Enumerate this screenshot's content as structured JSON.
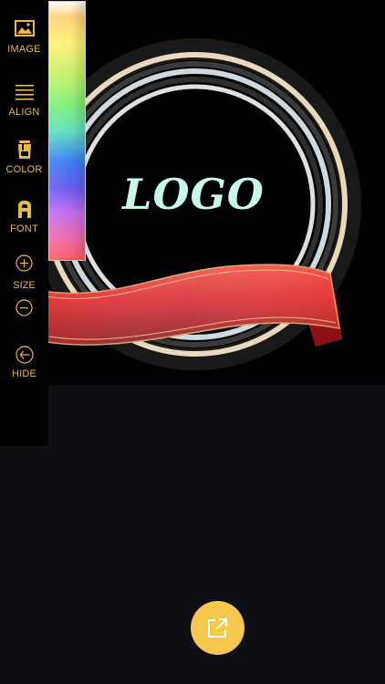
{
  "toolbar": {
    "image_label": "IMAGE",
    "align_label": "ALIGN",
    "color_label": "COLOR",
    "font_label": "FONT",
    "size_label": "SIZE",
    "hide_label": "HIDE",
    "icons": {
      "image": "image-icon",
      "align": "align-icon",
      "color": "paint-bucket-icon",
      "font": "font-icon",
      "size_increase": "plus-circle-icon",
      "size_decrease": "minus-circle-icon",
      "hide": "arrow-left-circle-icon"
    },
    "accent_color": "#e9b949"
  },
  "canvas": {
    "logo_text": "LOGO",
    "logo_color": "#c9f8ee",
    "background": "#000000",
    "ribbon_color": "#d61f26",
    "ring_colors": [
      "#e8d8c0",
      "#d0d8df",
      "#3a3a3a"
    ]
  },
  "color_picker": {
    "type": "spectrum-slider"
  },
  "share_button": {
    "icon": "share-external-icon",
    "color": "#f7c84b"
  },
  "page": {
    "background": "#0f1014"
  }
}
